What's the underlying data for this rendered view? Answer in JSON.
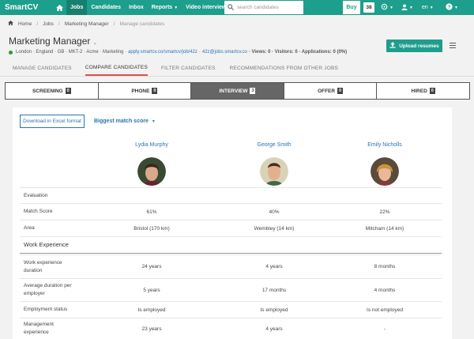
{
  "nav": {
    "brand": "SmartCV",
    "items": [
      {
        "label": "Jobs",
        "active": true
      },
      {
        "label": "Candidates",
        "active": false
      },
      {
        "label": "Inbox",
        "active": false
      },
      {
        "label": "Reports",
        "active": false,
        "caret": "▼"
      },
      {
        "label": "Video interviews",
        "active": false
      }
    ],
    "search_placeholder": "search candidates",
    "buy_label": "Buy",
    "count_badge": "38",
    "lang": "en"
  },
  "breadcrumb": {
    "home": "Home",
    "jobs": "Jobs",
    "job": "Marketing Manager",
    "current": "Manage candidates"
  },
  "job": {
    "title": "Marketing Manager",
    "meta_location": "London · England · GB · MKT-2 · Acme · Marketing ·",
    "meta_link1": "apply.smartcv.co/smartcv/job/42z",
    "meta_sep": "·",
    "meta_link2": "42z@jobs.smartcv.co",
    "meta_views": "· Views: 0 · Visitors: 0 · Applications: 0 (0%)",
    "upload_label": "Upload resumes"
  },
  "tabs": [
    "MANAGE CANDIDATES",
    "COMPARE CANDIDATES",
    "FILTER CANDIDATES",
    "RECOMMENDATIONS FROM OTHER JOBS"
  ],
  "stages": [
    {
      "label": "SCREENING",
      "count": "0",
      "active": false
    },
    {
      "label": "PHONE",
      "count": "0",
      "active": false
    },
    {
      "label": "INTERVIEW",
      "count": "3",
      "active": true
    },
    {
      "label": "OFFER",
      "count": "0",
      "active": false
    },
    {
      "label": "HIRED",
      "count": "0",
      "active": false
    }
  ],
  "compare": {
    "excel_label": "Download in Excel format",
    "sort_label": "Biggest match score",
    "candidates": [
      {
        "name": "Lydia Murphy"
      },
      {
        "name": "George Smith"
      },
      {
        "name": "Emily Nicholls"
      }
    ],
    "rows": [
      {
        "label": "Evaluation",
        "values": [
          "",
          "",
          ""
        ]
      },
      {
        "label": "Match Score",
        "values": [
          "61%",
          "40%",
          "22%"
        ]
      },
      {
        "label": "Area",
        "values": [
          "Bristol (170 km)",
          "Wembley (14 km)",
          "Mitcham (14 km)"
        ]
      },
      {
        "label": "Work Experience",
        "section": true
      },
      {
        "label": "Work experience duration",
        "values": [
          "24 years",
          "4 years",
          "8 months"
        ]
      },
      {
        "label": "Average duration per employer",
        "values": [
          "5 years",
          "17 months",
          "4 months"
        ]
      },
      {
        "label": "Employment status",
        "values": [
          "Is employed",
          "Is employed",
          "Is not employed"
        ]
      },
      {
        "label": "Management experience",
        "values": [
          "23 years",
          "4 years",
          "-"
        ]
      }
    ]
  },
  "colors": {
    "brand": "#1e9e8c",
    "link": "#2a74b8",
    "active_tab": "#d9534f"
  }
}
